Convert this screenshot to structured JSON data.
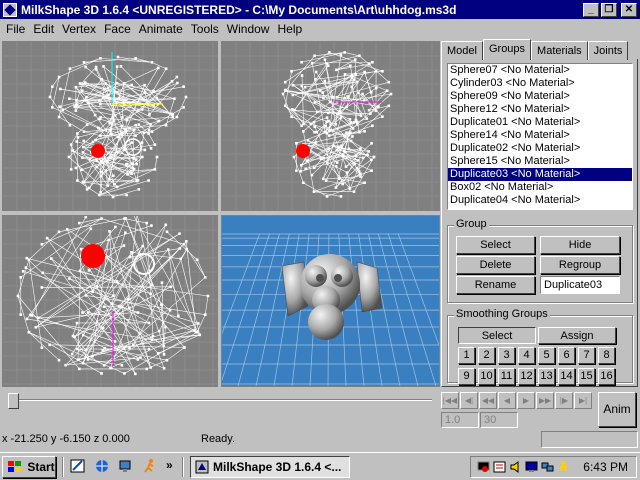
{
  "window": {
    "title": "MilkShape 3D 1.6.4 <UNREGISTERED> - C:\\My Documents\\Art\\uhhdog.ms3d",
    "minimize": "_",
    "maximize": "❐",
    "close": "✕"
  },
  "menu": [
    "File",
    "Edit",
    "Vertex",
    "Face",
    "Animate",
    "Tools",
    "Window",
    "Help"
  ],
  "tabs": [
    "Model",
    "Groups",
    "Materials",
    "Joints"
  ],
  "active_tab": "Groups",
  "groups_list": [
    "Sphere07 <No Material>",
    "Cylinder03 <No Material>",
    "Sphere09 <No Material>",
    "Sphere12 <No Material>",
    "Duplicate01 <No Material>",
    "Sphere14 <No Material>",
    "Duplicate02 <No Material>",
    "Sphere15 <No Material>",
    "Duplicate03 <No Material>",
    "Box02 <No Material>",
    "Duplicate04 <No Material>"
  ],
  "selected_group": "Duplicate03 <No Material>",
  "group_box": {
    "label": "Group",
    "select": "Select",
    "hide": "Hide",
    "delete": "Delete",
    "regroup": "Regroup",
    "rename": "Rename",
    "name_value": "Duplicate03"
  },
  "smoothing": {
    "label": "Smoothing Groups",
    "select": "Select",
    "assign": "Assign",
    "numbers": [
      "1",
      "2",
      "3",
      "4",
      "5",
      "6",
      "7",
      "8",
      "9",
      "10",
      "11",
      "12",
      "13",
      "14",
      "15",
      "16"
    ]
  },
  "timeline": {
    "anim_button": "Anim",
    "frame_start": "1.0",
    "frame_end": "30"
  },
  "status": {
    "coords": "x -21.250 y -6.150 z 0.000",
    "message": "Ready."
  },
  "taskbar": {
    "start": "Start",
    "chevron": "»",
    "task": "MilkShape 3D 1.6.4 <...",
    "clock": "6:43 PM"
  },
  "colors": {
    "titlebar": "#000080",
    "face": "#c0c0c0",
    "viewport_bg": "#808080",
    "perspective_bg": "#3a7fbf",
    "selection": "#000080",
    "selected_vertices": "#ff0000"
  }
}
